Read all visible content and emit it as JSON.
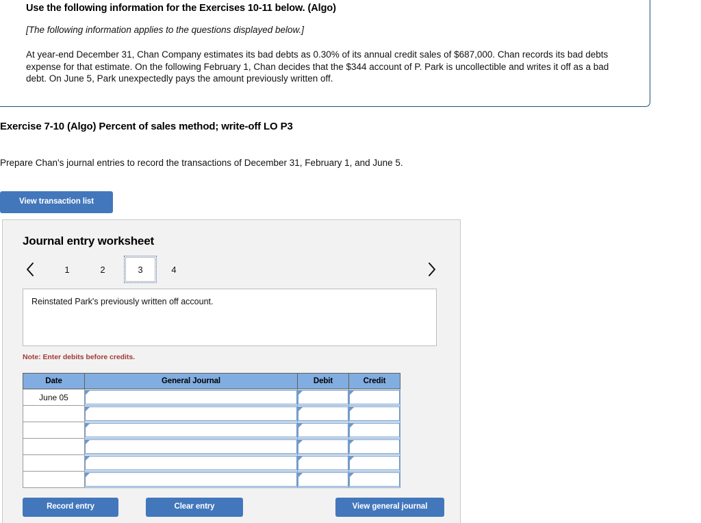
{
  "info_box": {
    "title": "Use the following information for the Exercises 10-11 below. (Algo)",
    "italic_note": "[The following information applies to the questions displayed below.]",
    "body": "At year-end December 31, Chan Company estimates its bad debts as 0.30% of its annual credit sales of $687,000. Chan records its bad debts expense for that estimate. On the following February 1, Chan decides that the $344 account of P. Park is uncollectible and writes it off as a bad debt. On June 5, Park unexpectedly pays the amount previously written off."
  },
  "exercise": {
    "title": "Exercise 7-10 (Algo) Percent of sales method; write-off LO P3",
    "prompt": "Prepare Chan's journal entries to record the transactions of December 31, February 1, and June 5.",
    "view_transaction_list_label": "View transaction list"
  },
  "worksheet": {
    "title": "Journal entry worksheet",
    "tabs": [
      {
        "label": "1",
        "active": false
      },
      {
        "label": "2",
        "active": false
      },
      {
        "label": "3",
        "active": true
      },
      {
        "label": "4",
        "active": false
      }
    ],
    "prev_icon": "chevron-left-icon",
    "next_icon": "chevron-right-icon",
    "description": "Reinstated Park's previously written off account.",
    "note": "Note: Enter debits before credits.",
    "table": {
      "headers": [
        "Date",
        "General Journal",
        "Debit",
        "Credit"
      ],
      "rows": [
        {
          "date": "June 05",
          "general_journal": "",
          "debit": "",
          "credit": ""
        },
        {
          "date": "",
          "general_journal": "",
          "debit": "",
          "credit": ""
        },
        {
          "date": "",
          "general_journal": "",
          "debit": "",
          "credit": ""
        },
        {
          "date": "",
          "general_journal": "",
          "debit": "",
          "credit": ""
        },
        {
          "date": "",
          "general_journal": "",
          "debit": "",
          "credit": ""
        },
        {
          "date": "",
          "general_journal": "",
          "debit": "",
          "credit": ""
        }
      ]
    },
    "buttons": {
      "record_entry": "Record entry",
      "clear_entry": "Clear entry",
      "view_general_journal": "View general journal"
    }
  },
  "colors": {
    "button_blue": "#4377bc",
    "table_header_blue": "#82ade0",
    "note_red": "#a33a36",
    "info_border_blue": "#1f4e79",
    "panel_bg": "#f2f2f2"
  }
}
